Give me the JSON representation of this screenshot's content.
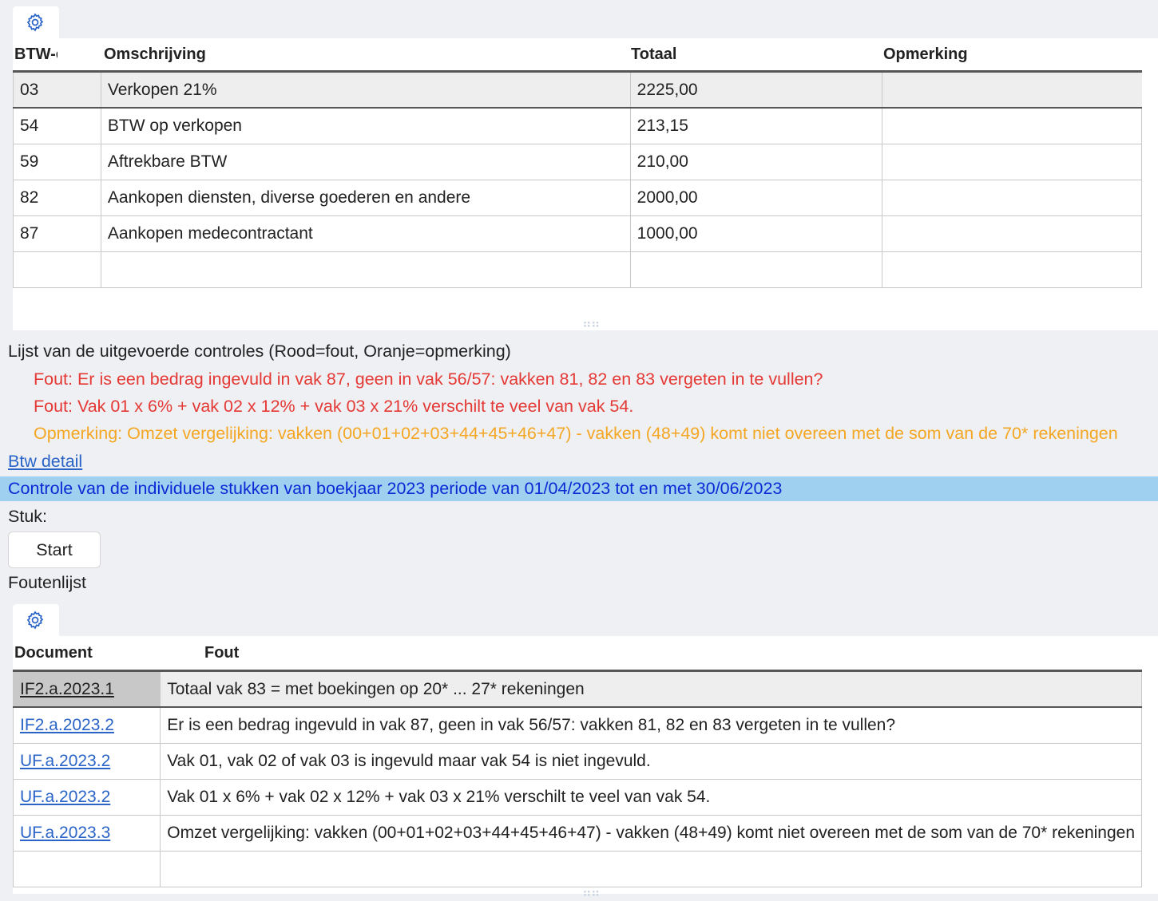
{
  "btw_grid": {
    "columns": [
      "BTW-c",
      "Omschrijving",
      "Totaal",
      "Opmerking"
    ],
    "rows": [
      {
        "code": "03",
        "desc": "Verkopen 21%",
        "total": "2225,00",
        "note": ""
      },
      {
        "code": "54",
        "desc": "BTW op verkopen",
        "total": "213,15",
        "note": ""
      },
      {
        "code": "59",
        "desc": "Aftrekbare BTW",
        "total": "210,00",
        "note": ""
      },
      {
        "code": "82",
        "desc": "Aankopen diensten, diverse goederen en andere",
        "total": "2000,00",
        "note": ""
      },
      {
        "code": "87",
        "desc": "Aankopen medecontractant",
        "total": "1000,00",
        "note": ""
      },
      {
        "code": "",
        "desc": "",
        "total": "",
        "note": ""
      }
    ]
  },
  "checks": {
    "heading": "Lijst van de uitgevoerde controles (Rood=fout, Oranje=opmerking)",
    "error1": "Fout: Er is een bedrag ingevuld in vak 87, geen in vak 56/57: vakken 81, 82 en 83 vergeten in te vullen?",
    "error2": "Fout: Vak 01 x 6% + vak 02 x 12% + vak 03 x 21% verschilt te veel van vak 54.",
    "warning1": "Opmerking: Omzet vergelijking: vakken (00+01+02+03+44+45+46+47) - vakken (48+49) komt niet overeen met de som van de 70* rekeningen",
    "error_color": "#e53935",
    "warning_color": "#f5a623"
  },
  "btw_detail_link": "Btw detail",
  "banner": "Controle van de individuele stukken van boekjaar 2023 periode van 01/04/2023 tot en met 30/06/2023",
  "stuk_label": "Stuk:",
  "start_button": "Start",
  "foutenlijst_label": "Foutenlijst",
  "fout_grid": {
    "columns": [
      "Document",
      "Fout"
    ],
    "rows": [
      {
        "doc": "IF2.a.2023.1",
        "fout": "Totaal vak 83 = met boekingen op 20* ... 27* rekeningen"
      },
      {
        "doc": "IF2.a.2023.2",
        "fout": "Er is een bedrag ingevuld in vak 87, geen in vak 56/57: vakken 81, 82 en 83 vergeten in te vullen?"
      },
      {
        "doc": "UF.a.2023.2",
        "fout": "Vak 01, vak 02 of vak 03 is ingevuld maar vak 54 is niet ingevuld."
      },
      {
        "doc": "UF.a.2023.2",
        "fout": "Vak 01 x 6% + vak 02 x 12% + vak 03 x 21% verschilt te veel van vak 54."
      },
      {
        "doc": "UF.a.2023.3",
        "fout": "Omzet vergelijking: vakken (00+01+02+03+44+45+46+47) - vakken (48+49) komt niet overeen met de som van de 70* rekeningen"
      },
      {
        "doc": "",
        "fout": ""
      }
    ]
  }
}
